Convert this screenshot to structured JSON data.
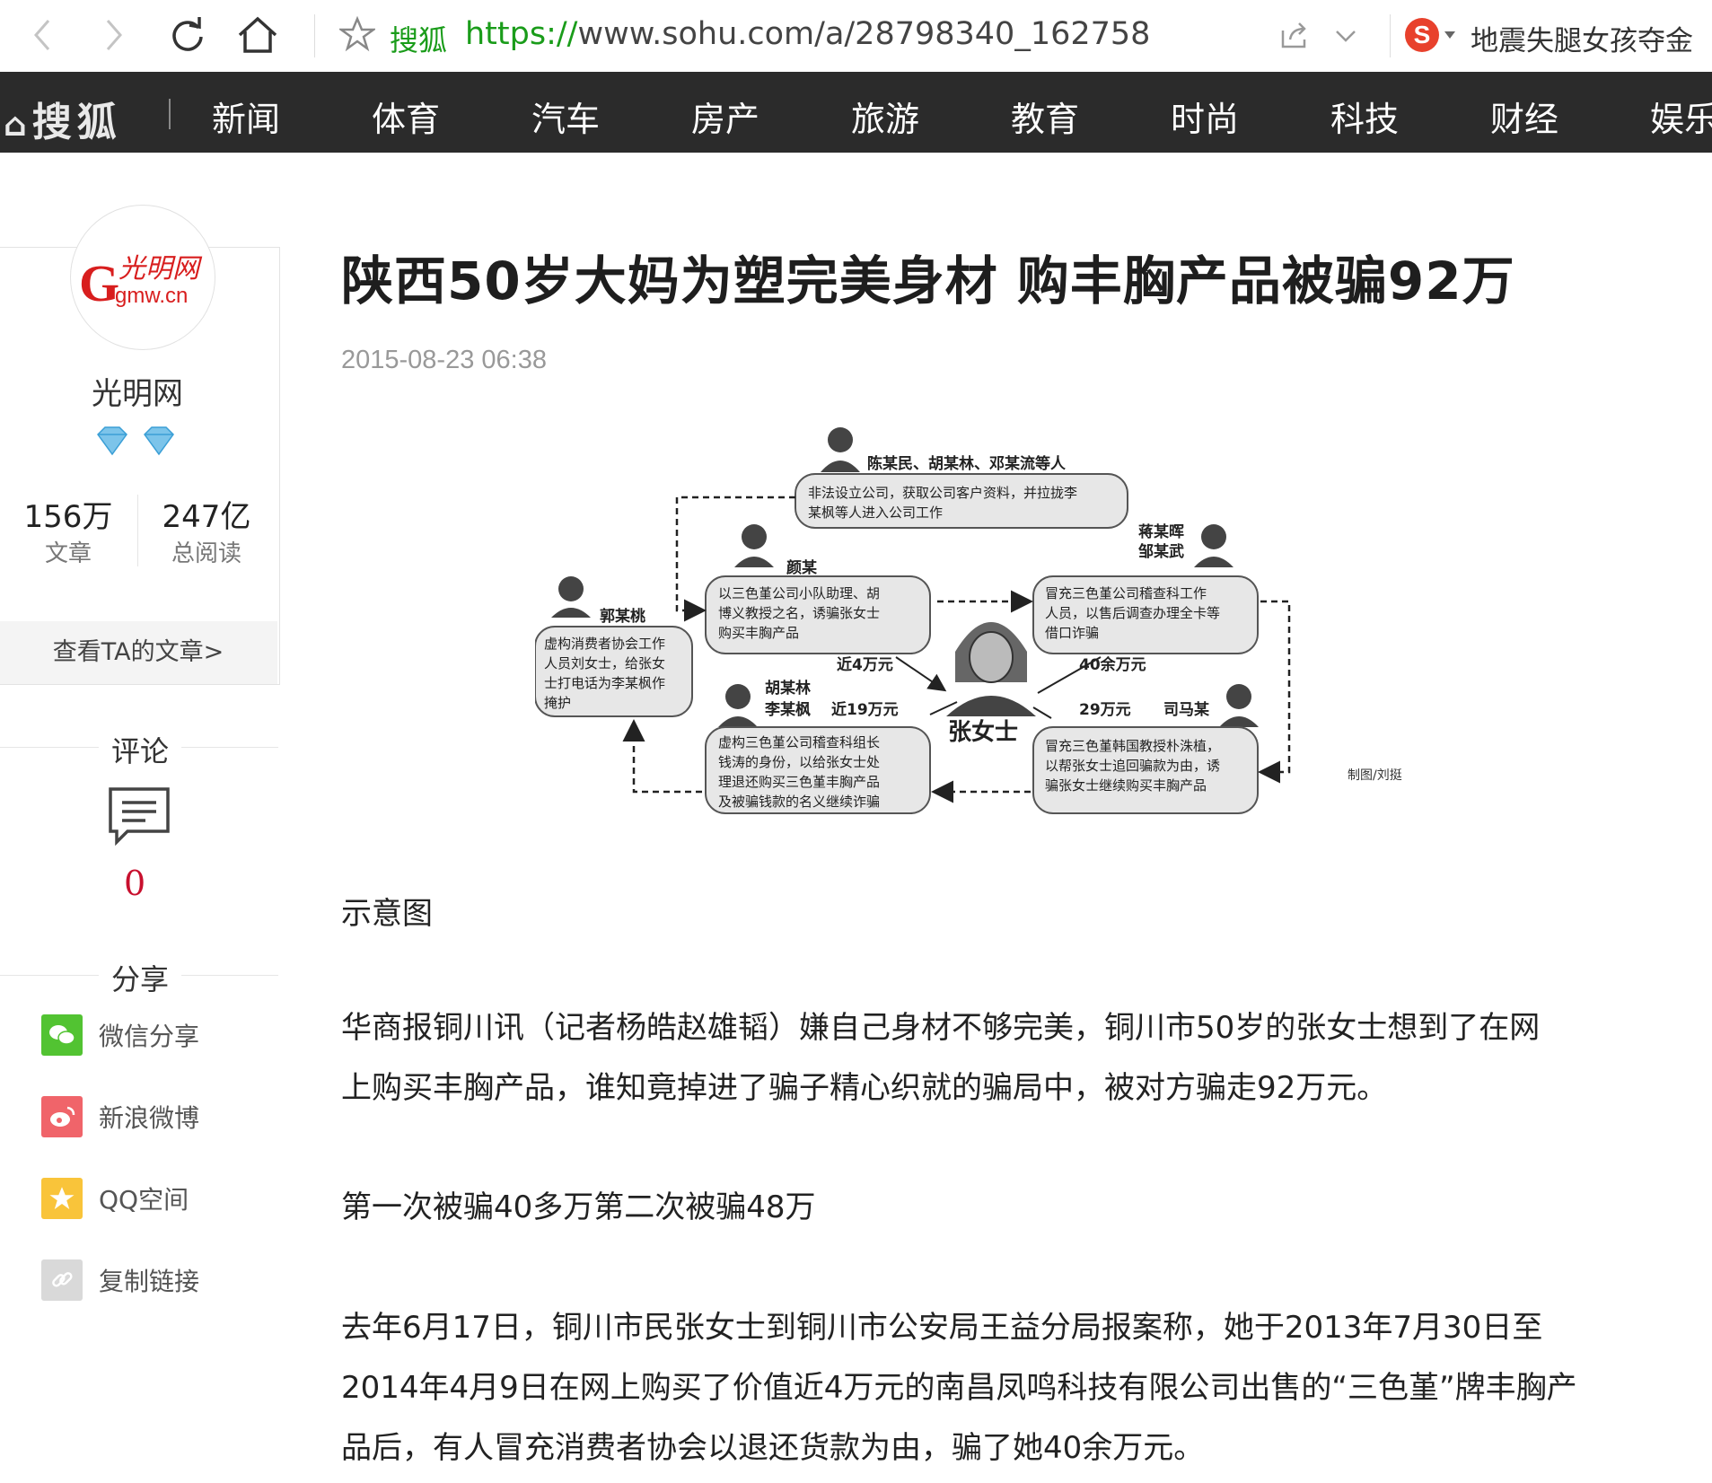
{
  "browser": {
    "site_label": "搜狐",
    "url_protocol": "https://",
    "url_rest": "www.sohu.com/a/28798340_162758",
    "search_hot": "地震失腿女孩夺金"
  },
  "nav": {
    "logo": "搜狐",
    "items": [
      "新闻",
      "体育",
      "汽车",
      "房产",
      "旅游",
      "教育",
      "时尚",
      "科技",
      "财经",
      "娱乐"
    ]
  },
  "author": {
    "name": "光明网",
    "logo_text_cn": "光明网",
    "logo_text_en": "gmw.cn",
    "articles_count": "156万",
    "articles_label": "文章",
    "reads_count": "247亿",
    "reads_label": "总阅读",
    "more_link": "查看TA的文章>"
  },
  "comments": {
    "title": "评论",
    "count": "0"
  },
  "share": {
    "title": "分享",
    "items": [
      "微信分享",
      "新浪微博",
      "QQ空间",
      "复制链接"
    ]
  },
  "article": {
    "title": "陕西50岁大妈为塑完美身材 购丰胸产品被骗92万",
    "date": "2015-08-23 06:38",
    "caption": "示意图",
    "p1_line1": "华商报铜川讯（记者杨皓赵雄韬）嫌自己身材不够完美，铜川市50岁的张女士想到了在网",
    "p1_line2": "上购买丰胸产品，谁知竟掉进了骗子精心织就的骗局中，被对方骗走92万元。",
    "p2": "第一次被骗40多万第二次被骗48万",
    "p3_line1": "去年6月17日，铜川市民张女士到铜川市公安局王益分局报案称，她于2013年7月30日至",
    "p3_line2": "2014年4月9日在网上购买了价值近4万元的南昌凤鸣科技有限公司出售的“三色堇”牌丰胸产",
    "p3_line3": "品后，有人冒充消费者协会以退还货款为由，骗了她40余万元。"
  },
  "diagram": {
    "top_names": "陈某民、胡某林、邓某流等人",
    "top_text1": "非法设立公司，获取公司客户资料，并拉拢李",
    "top_text2": "某枫等人进入公司工作",
    "left_top_name": "颜某",
    "left_top_text1": "以三色堇公司小队助理、胡",
    "left_top_text2": "博义教授之名，诱骗张女士",
    "left_top_text3": "购买丰胸产品",
    "right_top_names1": "蒋某晖",
    "right_top_names2": "邹某武",
    "right_top_text1": "冒充三色堇公司稽查科工作",
    "right_top_text2": "人员，以售后调查办理全卡等",
    "right_top_text3": "借口诈骗",
    "far_left_name": "郭某桃",
    "far_left_text1": "虚构消费者协会工作",
    "far_left_text2": "人员刘女士，给张女",
    "far_left_text3": "士打电话为李某枫作",
    "far_left_text4": "掩护",
    "amt_4": "近4万元",
    "amt_40": "40余万元",
    "center_name": "张女士",
    "bottom_left_names1": "胡某林",
    "bottom_left_names2": "李某枫",
    "amt_19": "近19万元",
    "bottom_left_text1": "虚构三色堇公司稽查科组长",
    "bottom_left_text2": "钱涛的身份，以给张女士处",
    "bottom_left_text3": "理退还购买三色堇丰胸产品",
    "bottom_left_text4": "及被骗钱款的名义继续诈骗",
    "amt_29": "29万元",
    "bottom_right_name": "司马某",
    "bottom_right_text1": "冒充三色堇韩国教授朴洙植，",
    "bottom_right_text2": "以帮张女士追回骗款为由，诱",
    "bottom_right_text3": "骗张女士继续购买丰胸产品",
    "credit": "制图/刘挺"
  }
}
